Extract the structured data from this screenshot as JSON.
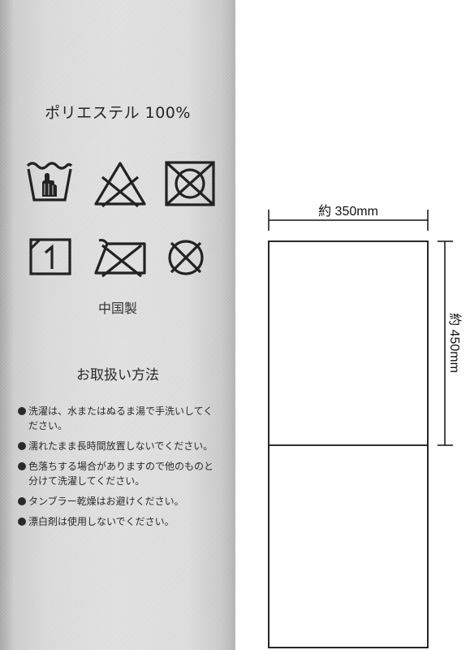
{
  "label": {
    "fabric": "ポリエステル 100%",
    "care_symbols": [
      {
        "name": "hand-wash-icon",
        "meaning": "hand wash"
      },
      {
        "name": "no-bleach-icon",
        "meaning": "do not bleach"
      },
      {
        "name": "no-tumble-dry-icon",
        "meaning": "do not tumble dry"
      },
      {
        "name": "line-dry-icon",
        "meaning": "hang dry"
      },
      {
        "name": "no-iron-icon",
        "meaning": "do not iron"
      },
      {
        "name": "no-dry-clean-icon",
        "meaning": "do not dry clean"
      }
    ],
    "origin": "中国製",
    "handling_title": "お取扱い方法",
    "notes": [
      "洗濯は、水またはぬるま湯で手洗いしてください。",
      "濡れたまま長時間放置しないでください。",
      "色落ちする場合がありますので他のものと分けて洗濯してください。",
      "タンブラー乾燥はお避けください。",
      "漂白剤は使用しないでください。"
    ]
  },
  "diagram": {
    "width_label": "約 350mm",
    "height_label": "約 450mm"
  }
}
